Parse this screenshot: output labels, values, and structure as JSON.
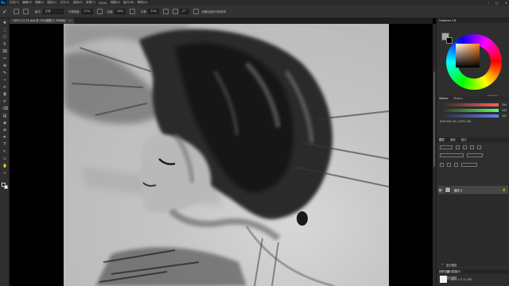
{
  "app": {
    "logo": "Ps"
  },
  "menu": [
    "文件(F)",
    "编辑(E)",
    "图像(I)",
    "图层(L)",
    "文字(Y)",
    "选择(S)",
    "滤镜(T)",
    "3D(D)",
    "视图(V)",
    "窗口(W)",
    "帮助(H)"
  ],
  "window_controls": {
    "minimize": "–",
    "maximize": "□",
    "close": "✕"
  },
  "options": {
    "mode_label": "模式:",
    "mode_value": "正常",
    "opacity_label": "不透明度:",
    "opacity_value": "47%",
    "flow_label": "流量:",
    "flow_value": "40%",
    "smoothing_label": "平滑:",
    "smoothing_value": "10%",
    "angle_value": "0°",
    "pressure_label": "设置绘画的对称选项"
  },
  "document_tab": {
    "title": "1057-1-2 11.psd @ 15%(图层 0, RGB/8)",
    "close": "×"
  },
  "tools": [
    "✥",
    "⬚",
    "ⓛ",
    "⚲",
    "⌧",
    "✂",
    "⊕",
    "✎",
    "⌁",
    "✍",
    "⧉",
    "✐",
    "⌫",
    "▤",
    "◈",
    "⊚",
    "✒",
    "T",
    "↖",
    "▭",
    "✋",
    "⌕",
    "…"
  ],
  "panels": {
    "color_tab": "Coolorus 2.6",
    "hex_value": "A4A4A4",
    "slider_tabs": [
      "Sliders",
      "Mixers"
    ],
    "sliders": [
      {
        "gradient": "linear-gradient(to right,#2a2a2a,#ff6060)",
        "value": "164"
      },
      {
        "gradient": "linear-gradient(to right,#2a2a2a,#60ff60)",
        "value": "162"
      },
      {
        "gradient": "linear-gradient(to right,#2a2a2a,#6080ff)",
        "value": "162"
      }
    ],
    "color_modes": "RGB HSB HSL CMYK LAB",
    "layer_tabs": [
      "图层",
      "通道",
      "路径"
    ],
    "layer": {
      "name": "图层 0",
      "eye": "👁",
      "lock": "🔒"
    },
    "history_tabs": [
      "历史记录",
      "动作"
    ],
    "history_snapshot": "1057-1-2 11.JPG",
    "history_items": [
      "显示图层",
      "显示图层",
      "显示图层"
    ]
  },
  "colors": {
    "accent": "#31a8ff",
    "bg_panel": "#2e2e2e",
    "canvas_bg": "#c4c4c4"
  }
}
